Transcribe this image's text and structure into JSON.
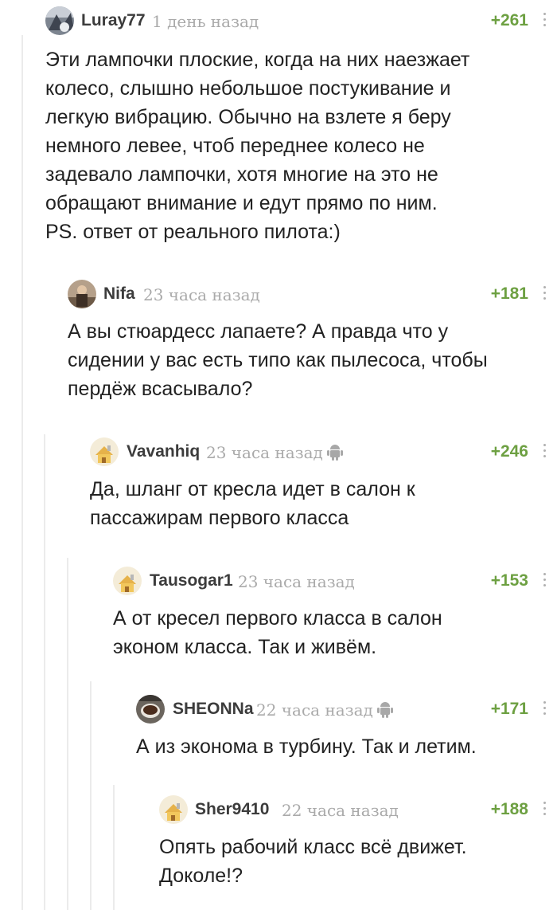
{
  "comments": [
    {
      "user": "Luray77",
      "time": "1 день назад",
      "rating": "+261",
      "text": "Эти лампочки плоские, когда на них наезжает\nколесо, слышно небольшое постукивание и\nлегкую вибрацию.  Обычно на взлете я беру\nнемного левее, чтоб переднее колесо не\nзадевало лампочки, хотя многие на это не\nобращают внимание и едут прямо по ним.\nPS. ответ от реального пилота:)"
    },
    {
      "user": "Nifa",
      "time": "23 часа назад",
      "rating": "+181",
      "text": "А вы стюардесс лапаете? А правда что у\nсидении у вас есть типо как пылесоса, чтобы\nпердёж всасывало?"
    },
    {
      "user": "Vavanhiq",
      "time": "23 часа назад",
      "rating": "+246",
      "text": "Да, шланг от кресла идет в салон к\nпассажирам первого класса"
    },
    {
      "user": "Tausogar1",
      "time": "23 часа назад",
      "rating": "+153",
      "text": "А от кресел первого класса в салон\nэконом класса. Так и живём."
    },
    {
      "user": "SHEONNa",
      "time": "22 часа назад",
      "rating": "+171",
      "text": "А из эконома в турбину. Так и летим."
    },
    {
      "user": "Sher9410",
      "time": "22 часа назад",
      "rating": "+188",
      "text": "Опять рабочий класс всё движет.\nДоколе!?"
    }
  ]
}
